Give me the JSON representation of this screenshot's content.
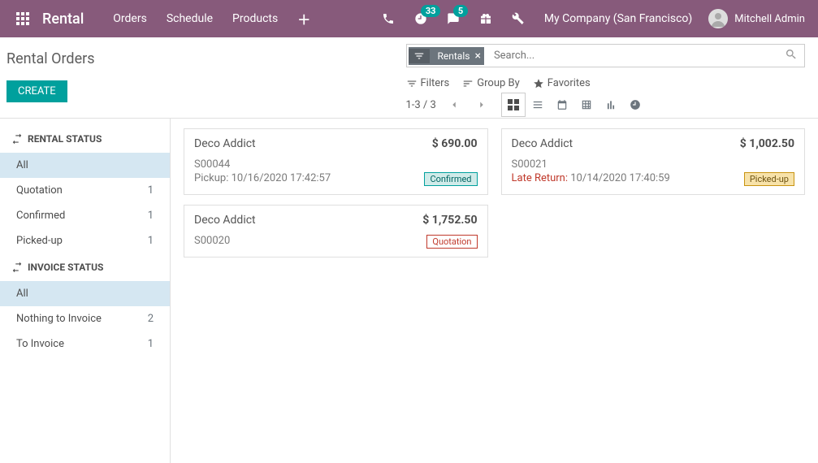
{
  "navbar": {
    "app_name": "Rental",
    "links": [
      "Orders",
      "Schedule",
      "Products"
    ],
    "badges": {
      "clock": "33",
      "chat": "5"
    },
    "company": "My Company (San Francisco)",
    "user": "Mitchell Admin"
  },
  "control": {
    "breadcrumb": "Rental Orders",
    "create": "CREATE",
    "facet": "Rentals",
    "search_placeholder": "Search...",
    "filters": "Filters",
    "groupby": "Group By",
    "favorites": "Favorites",
    "pager": "1-3 / 3"
  },
  "sidebar": {
    "s1_title": "RENTAL STATUS",
    "s1_items": [
      {
        "label": "All",
        "count": "",
        "active": true
      },
      {
        "label": "Quotation",
        "count": "1"
      },
      {
        "label": "Confirmed",
        "count": "1"
      },
      {
        "label": "Picked-up",
        "count": "1"
      }
    ],
    "s2_title": "INVOICE STATUS",
    "s2_items": [
      {
        "label": "All",
        "count": "",
        "active": true
      },
      {
        "label": "Nothing to Invoice",
        "count": "2"
      },
      {
        "label": "To Invoice",
        "count": "1"
      }
    ]
  },
  "cards": {
    "c1": {
      "customer": "Deco Addict",
      "price": "$ 690.00",
      "ref": "S00044",
      "line_label": "Pickup: ",
      "line_date": "10/16/2020 17:42:57",
      "status": "Confirmed"
    },
    "c2": {
      "customer": "Deco Addict",
      "price": "$ 1,752.50",
      "ref": "S00020",
      "status": "Quotation"
    },
    "c3": {
      "customer": "Deco Addict",
      "price": "$ 1,002.50",
      "ref": "S00021",
      "line_label": "Late Return: ",
      "line_date": "10/14/2020 17:40:59",
      "status": "Picked-up"
    }
  }
}
